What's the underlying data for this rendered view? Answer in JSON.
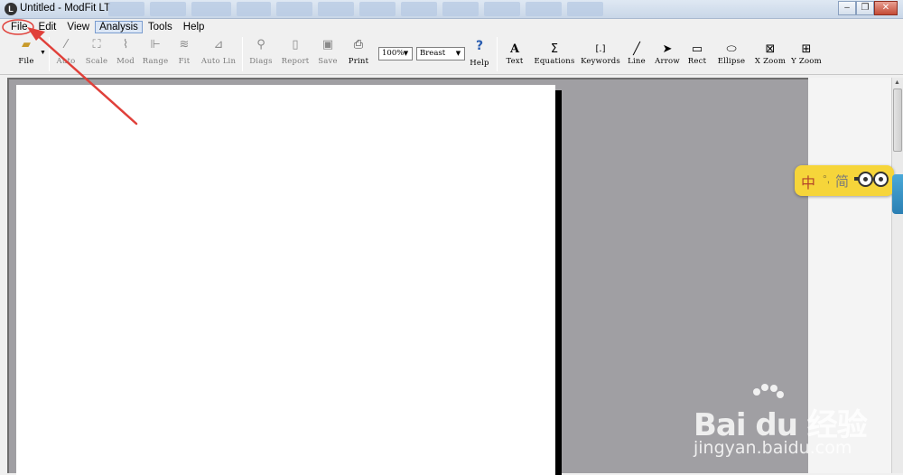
{
  "window": {
    "app_icon": "modfit-logo-icon",
    "title": "Untitled - ModFit LT",
    "taskbar_tab_count": 12
  },
  "menu": {
    "items": [
      "File",
      "Edit",
      "View",
      "Analysis",
      "Tools",
      "Help"
    ],
    "active": "Analysis"
  },
  "toolbar": {
    "buttons": [
      {
        "id": "file",
        "label": "File",
        "icon": "folder-open-icon",
        "enabled": true
      },
      {
        "id": "auto",
        "label": "Auto",
        "icon": "magic-wand-icon",
        "enabled": false
      },
      {
        "id": "scale",
        "label": "Scale",
        "icon": "scale-icon",
        "enabled": false
      },
      {
        "id": "mod",
        "label": "Mod",
        "icon": "model-icon",
        "enabled": false
      },
      {
        "id": "range",
        "label": "Range",
        "icon": "range-icon",
        "enabled": false
      },
      {
        "id": "fit",
        "label": "Fit",
        "icon": "fit-icon",
        "enabled": false
      },
      {
        "id": "autolin",
        "label": "Auto Lin",
        "icon": "autolin-icon",
        "enabled": false
      },
      {
        "id": "diags",
        "label": "Diags",
        "icon": "diagnostics-icon",
        "enabled": false
      },
      {
        "id": "report",
        "label": "Report",
        "icon": "report-icon",
        "enabled": false
      },
      {
        "id": "save",
        "label": "Save",
        "icon": "save-icon",
        "enabled": false
      },
      {
        "id": "print",
        "label": "Print",
        "icon": "printer-icon",
        "enabled": true
      },
      {
        "id": "help",
        "label": "Help",
        "icon": "help-icon",
        "enabled": true
      },
      {
        "id": "text",
        "label": "Text",
        "icon": "text-icon",
        "enabled": true
      },
      {
        "id": "equations",
        "label": "Equations",
        "icon": "sigma-icon",
        "enabled": true
      },
      {
        "id": "keywords",
        "label": "Keywords",
        "icon": "brackets-icon",
        "enabled": true
      },
      {
        "id": "line",
        "label": "Line",
        "icon": "line-icon",
        "enabled": true
      },
      {
        "id": "arrow",
        "label": "Arrow",
        "icon": "arrow-cursor-icon",
        "enabled": true
      },
      {
        "id": "rect",
        "label": "Rect",
        "icon": "rectangle-icon",
        "enabled": true
      },
      {
        "id": "ellipse",
        "label": "Ellipse",
        "icon": "ellipse-icon",
        "enabled": true
      },
      {
        "id": "xzoom",
        "label": "X Zoom",
        "icon": "x-zoom-icon",
        "enabled": true
      },
      {
        "id": "yzoom",
        "label": "Y Zoom",
        "icon": "y-zoom-icon",
        "enabled": true
      }
    ],
    "zoom_select": {
      "value": "100%"
    },
    "template_select": {
      "value": "Breast"
    }
  },
  "ime": {
    "lang": "中",
    "dot": "°,",
    "mode": "简"
  },
  "watermark": {
    "brand": "Bai du 经验",
    "url": "jingyan.baidu.com"
  },
  "annotation": {
    "color": "#e0403a"
  }
}
